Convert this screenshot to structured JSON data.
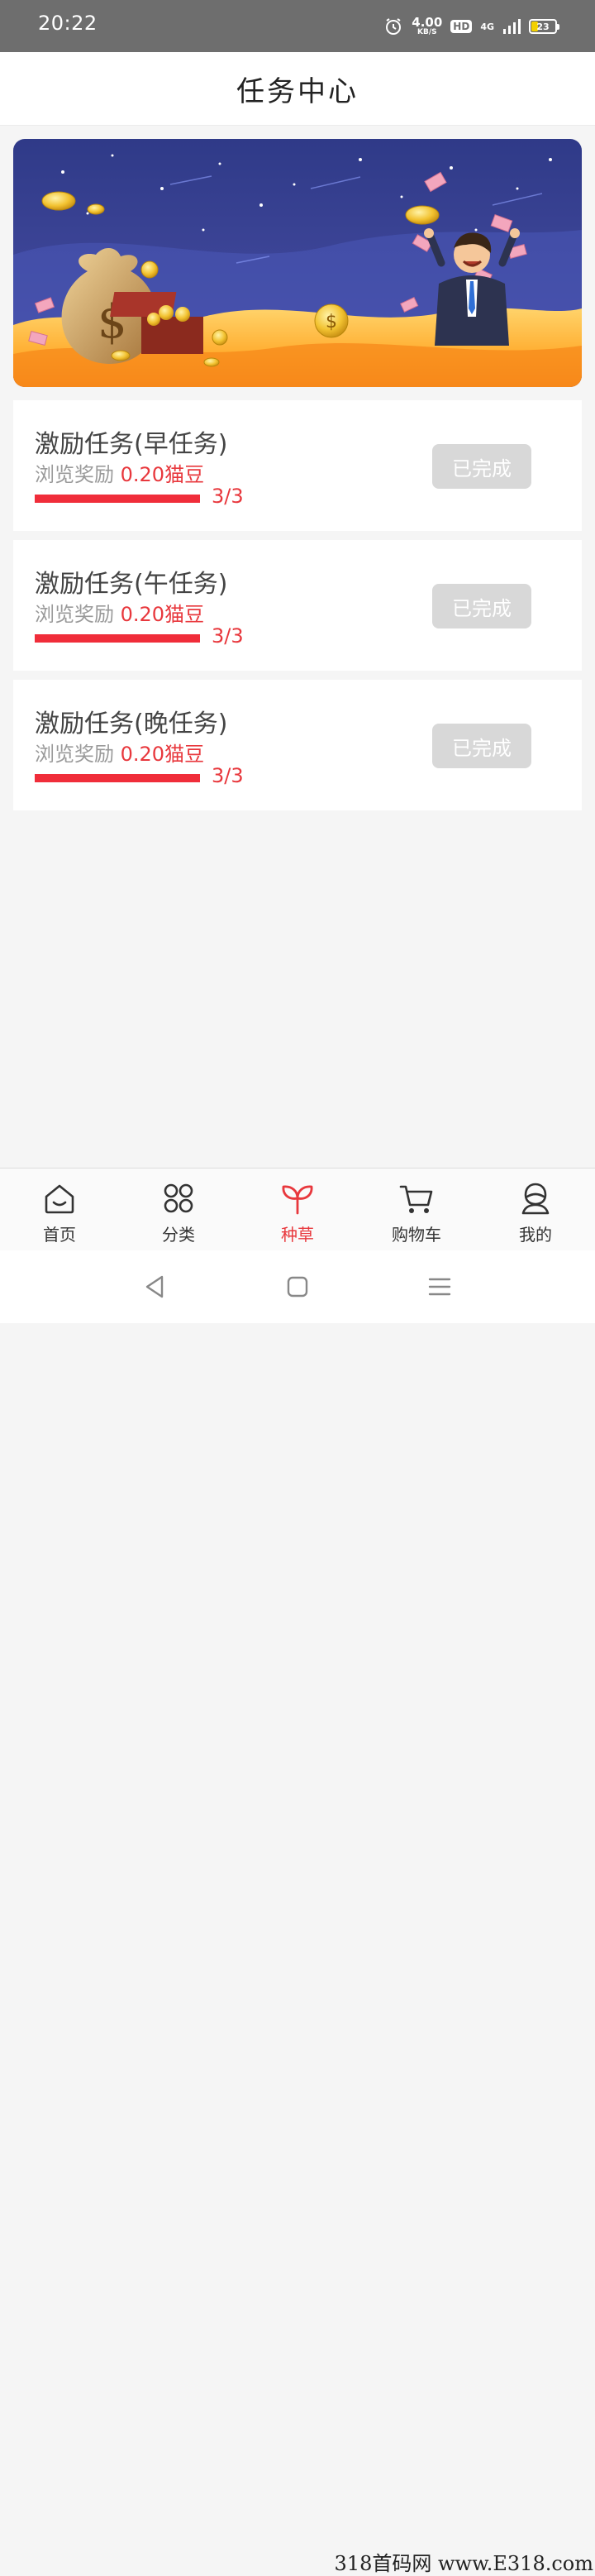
{
  "status_bar": {
    "time": "20:22",
    "net_speed": "4.00",
    "net_unit": "KB/S",
    "hd": "HD",
    "signal": "4G",
    "battery": "23"
  },
  "header": {
    "title": "任务中心"
  },
  "tasks": [
    {
      "title": "激励任务(早任务)",
      "reward_label": "浏览奖励",
      "reward_value": "0.20猫豆",
      "progress_text": "3/3",
      "progress": 1.0,
      "button_label": "已完成"
    },
    {
      "title": "激励任务(午任务)",
      "reward_label": "浏览奖励",
      "reward_value": "0.20猫豆",
      "progress_text": "3/3",
      "progress": 1.0,
      "button_label": "已完成"
    },
    {
      "title": "激励任务(晚任务)",
      "reward_label": "浏览奖励",
      "reward_value": "0.20猫豆",
      "progress_text": "3/3",
      "progress": 1.0,
      "button_label": "已完成"
    }
  ],
  "bottom_nav": {
    "items": [
      {
        "label": "首页",
        "icon": "home-icon",
        "active": false
      },
      {
        "label": "分类",
        "icon": "category-icon",
        "active": false
      },
      {
        "label": "种草",
        "icon": "sprout-icon",
        "active": true
      },
      {
        "label": "购物车",
        "icon": "cart-icon",
        "active": false
      },
      {
        "label": "我的",
        "icon": "user-icon",
        "active": false
      }
    ]
  },
  "colors": {
    "accent": "#e8383d",
    "progress": "#f02d3a",
    "done_button": "#d8d8d8"
  },
  "watermark": "318首码网 www.E318.com"
}
